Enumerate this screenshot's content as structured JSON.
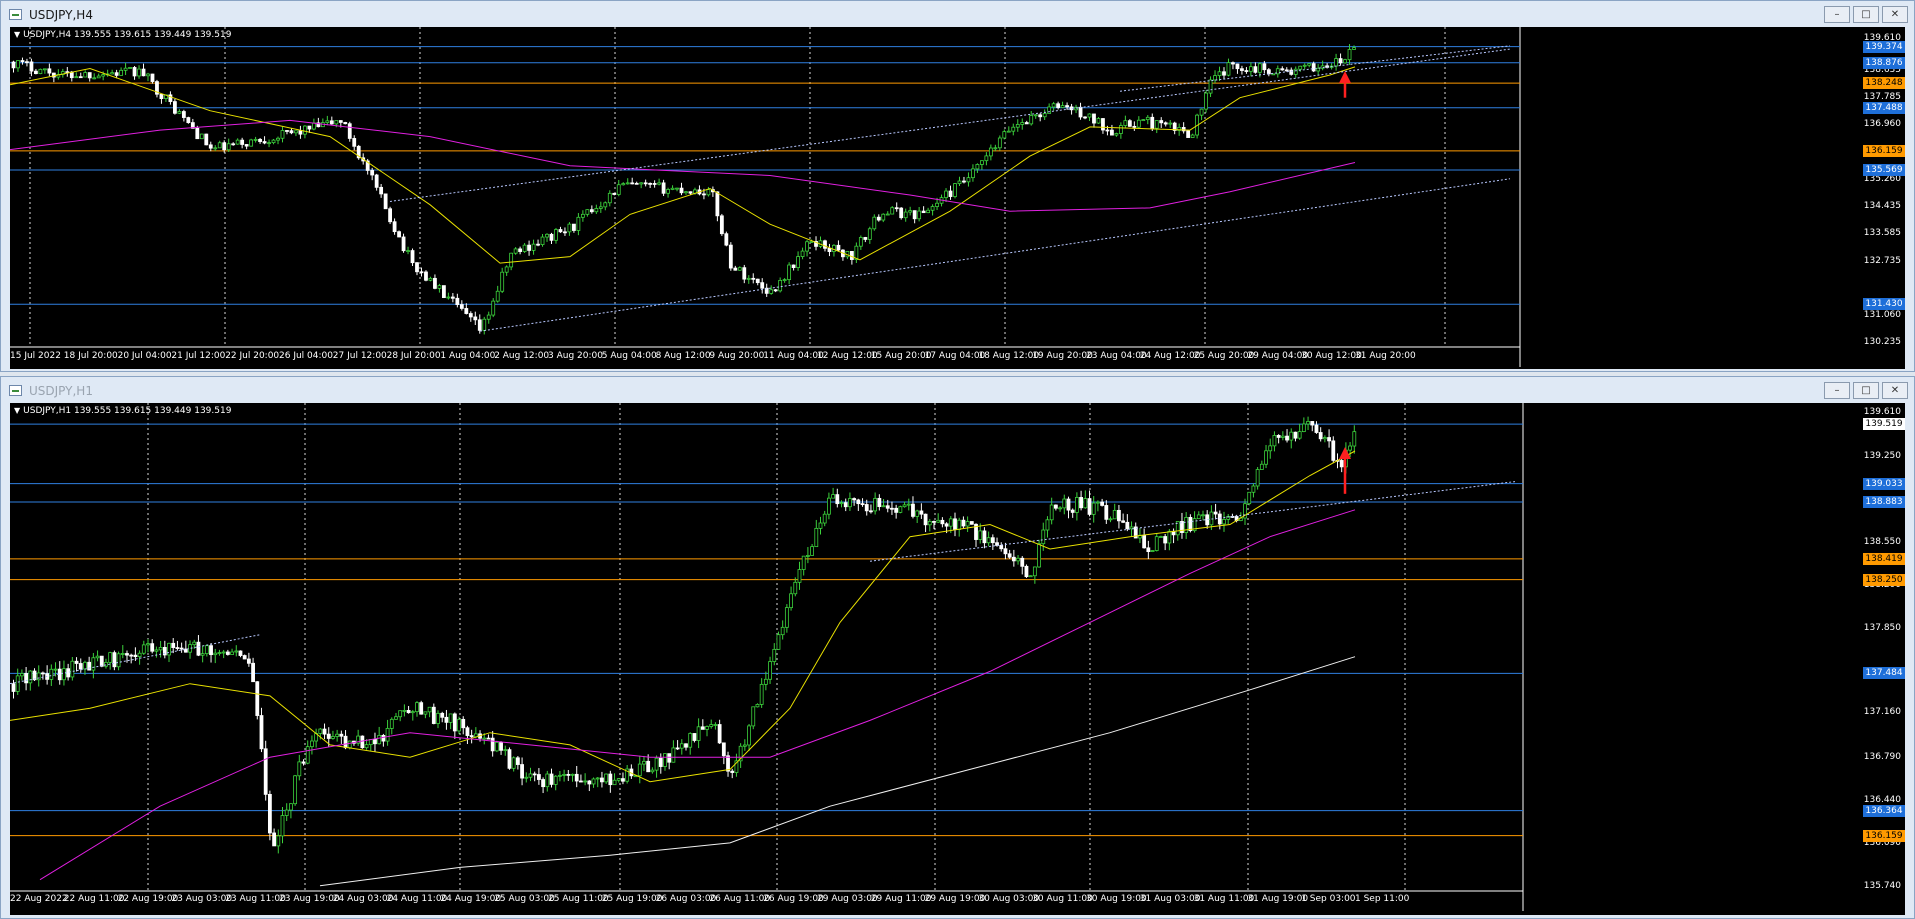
{
  "windows": [
    {
      "title": "USDJPY,H4",
      "header_text": "USDJPY,H4  139.555 139.615 139.449 139.519",
      "active": true,
      "price_range": [
        130.235,
        139.61
      ],
      "y_ticks": [
        "139.610",
        "138.635",
        "137.785",
        "136.960",
        "135.260",
        "134.435",
        "133.585",
        "132.735",
        "131.060",
        "130.235"
      ],
      "x_ticks": [
        "15 Jul 2022",
        "18 Jul 20:00",
        "20 Jul 04:00",
        "21 Jul 12:00",
        "22 Jul 20:00",
        "26 Jul 04:00",
        "27 Jul 12:00",
        "28 Jul 20:00",
        "1 Aug 04:00",
        "2 Aug 12:00",
        "3 Aug 20:00",
        "5 Aug 04:00",
        "8 Aug 12:00",
        "9 Aug 20:00",
        "11 Aug 04:00",
        "12 Aug 12:00",
        "15 Aug 20:00",
        "17 Aug 04:00",
        "18 Aug 12:00",
        "19 Aug 20:00",
        "23 Aug 04:00",
        "24 Aug 12:00",
        "25 Aug 20:00",
        "29 Aug 04:00",
        "30 Aug 12:00",
        "31 Aug 20:00"
      ],
      "levels": [
        {
          "value": 139.374,
          "label": "139.374",
          "color": "#2f7fe0",
          "bg": "#1e6fd9",
          "text": "#ffffff"
        },
        {
          "value": 138.876,
          "label": "138.876",
          "color": "#2f7fe0",
          "bg": "#1e6fd9",
          "text": "#ffffff"
        },
        {
          "value": 138.248,
          "label": "138.248",
          "color": "#ff9a00",
          "bg": "#ff9a00",
          "text": "#000000"
        },
        {
          "value": 137.488,
          "label": "137.488",
          "color": "#2f7fe0",
          "bg": "#1e6fd9",
          "text": "#ffffff"
        },
        {
          "value": 136.159,
          "label": "136.159",
          "color": "#ff9a00",
          "bg": "#ff9a00",
          "text": "#000000"
        },
        {
          "value": 135.569,
          "label": "135.569",
          "color": "#2f7fe0",
          "bg": "#1e6fd9",
          "text": "#ffffff"
        },
        {
          "value": 131.43,
          "label": "131.430",
          "color": "#2f7fe0",
          "bg": "#1e6fd9",
          "text": "#ffffff"
        }
      ]
    },
    {
      "title": "USDJPY,H1",
      "header_text": "USDJPY,H1  139.555 139.615 139.449 139.519",
      "active": false,
      "price_range": [
        135.74,
        139.61
      ],
      "y_ticks": [
        "139.610",
        "139.250",
        "138.550",
        "138.200",
        "137.850",
        "137.160",
        "136.790",
        "136.440",
        "136.090",
        "135.740"
      ],
      "x_ticks": [
        "22 Aug 2022",
        "22 Aug 11:00",
        "22 Aug 19:00",
        "23 Aug 03:00",
        "23 Aug 11:00",
        "23 Aug 19:00",
        "24 Aug 03:00",
        "24 Aug 11:00",
        "24 Aug 19:00",
        "25 Aug 03:00",
        "25 Aug 11:00",
        "25 Aug 19:00",
        "26 Aug 03:00",
        "26 Aug 11:00",
        "26 Aug 19:00",
        "29 Aug 03:00",
        "29 Aug 11:00",
        "29 Aug 19:00",
        "30 Aug 03:00",
        "30 Aug 11:00",
        "30 Aug 19:00",
        "31 Aug 03:00",
        "31 Aug 11:00",
        "31 Aug 19:00",
        "1 Sep 03:00",
        "1 Sep 11:00"
      ],
      "levels": [
        {
          "value": 139.519,
          "label": "139.519",
          "color": "#2f7fe0",
          "bg": "#ffffff",
          "text": "#000000"
        },
        {
          "value": 139.033,
          "label": "139.033",
          "color": "#2f7fe0",
          "bg": "#1e6fd9",
          "text": "#ffffff"
        },
        {
          "value": 138.883,
          "label": "138.883",
          "color": "#2f7fe0",
          "bg": "#1e6fd9",
          "text": "#ffffff"
        },
        {
          "value": 138.419,
          "label": "138.419",
          "color": "#ff9a00",
          "bg": "#ff9a00",
          "text": "#000000"
        },
        {
          "value": 138.25,
          "label": "138.250",
          "color": "#ff9a00",
          "bg": "#ff9a00",
          "text": "#000000"
        },
        {
          "value": 137.484,
          "label": "137.484",
          "color": "#2f7fe0",
          "bg": "#1e6fd9",
          "text": "#ffffff"
        },
        {
          "value": 136.364,
          "label": "136.364",
          "color": "#2f7fe0",
          "bg": "#1e6fd9",
          "text": "#ffffff"
        },
        {
          "value": 136.159,
          "label": "136.159",
          "color": "#ff9a00",
          "bg": "#ff9a00",
          "text": "#000000"
        }
      ]
    }
  ],
  "window_buttons": {
    "minimize": "–",
    "maximize": "□",
    "close": "✕"
  },
  "colors": {
    "background": "#000000",
    "bull_candle": "#3cd23c",
    "bear_candle": "#ffffff",
    "ma_fast": "#e8e000",
    "ma_slow": "#e020e0",
    "ma_long": "#f0f0f0",
    "trend_line": "#b8c8ff",
    "arrow": "#ff2020",
    "grid": "#ffffff"
  },
  "icons": [
    "window-icon",
    "minimize-icon",
    "maximize-icon",
    "close-icon",
    "dropdown-triangle-icon",
    "up-arrow-icon"
  ]
}
